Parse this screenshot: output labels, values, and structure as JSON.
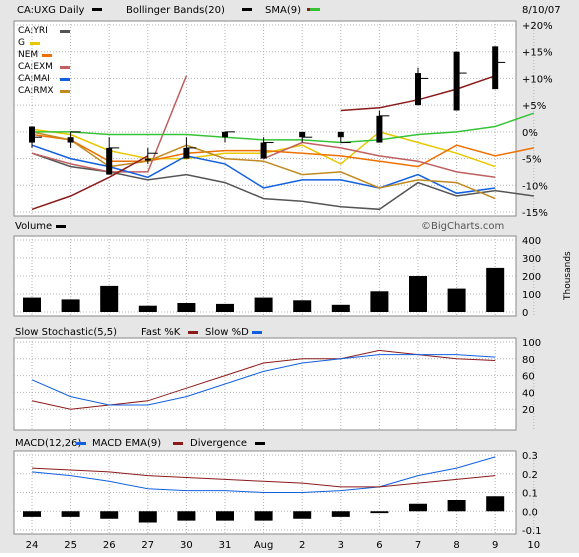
{
  "header": {
    "ticker_label": "CA:UXG Daily",
    "date_label": "8/10/07",
    "legend": [
      {
        "label": "Bollinger Bands(20)",
        "color": "#000000"
      },
      {
        "label": "SMA(9)",
        "color": "#8b1a1a"
      },
      {
        "label": "",
        "color": "#36c436"
      }
    ]
  },
  "price_legend": [
    {
      "label": "CA:YRI",
      "color": "#555555"
    },
    {
      "label": "G",
      "color": "#e8c800"
    },
    {
      "label": "NEM",
      "color": "#ee7000"
    },
    {
      "label": "CA:EXM",
      "color": "#c06060"
    },
    {
      "label": "CA:MAI",
      "color": "#1060e0"
    },
    {
      "label": "CA:RMX",
      "color": "#c08a20"
    }
  ],
  "volume_panel": {
    "title": "Volume",
    "watermark": "©BigCharts.com",
    "unit_label": "Thousands"
  },
  "stochastic_panel": {
    "title": "Slow Stochastic(5,5)",
    "legend": [
      {
        "label": "Fast %K",
        "color": "#8b1a1a"
      },
      {
        "label": "Slow %D",
        "color": "#1060e0"
      }
    ]
  },
  "macd_panel": {
    "title": "MACD(12,26)",
    "legend": [
      {
        "label": "MACD EMA(9)",
        "color": "#1060e0"
      },
      {
        "label": "Divergence",
        "color": "#000000"
      }
    ]
  },
  "colors": {
    "panel_bg": "#ffffff",
    "frame_bg": "#e6e6e6",
    "grid": "#b4b4b4",
    "macd": "#1060e0",
    "signal": "#8b1a1a"
  },
  "chart_data": {
    "type": "line",
    "x_labels": [
      "24",
      "25",
      "26",
      "27",
      "30",
      "31",
      "Aug",
      "2",
      "3",
      "6",
      "7",
      "8",
      "9",
      "10"
    ],
    "price": {
      "ylim": [
        -15,
        20
      ],
      "y_ticks": [
        20,
        15,
        10,
        5,
        0,
        -5,
        -10,
        -15
      ],
      "y_tick_labels": [
        "+20%",
        "+15%",
        "+10%",
        "+5%",
        "0%",
        "-5%",
        "-10%",
        "-15%"
      ],
      "candles": [
        {
          "x": 0,
          "o": -2,
          "c": 1,
          "h": 1,
          "l": -3
        },
        {
          "x": 1,
          "o": -1,
          "c": -2,
          "h": 0,
          "l": -3
        },
        {
          "x": 2,
          "o": -3,
          "c": -8,
          "h": -1,
          "l": -8
        },
        {
          "x": 3,
          "o": -5,
          "c": -5,
          "h": -3,
          "l": -6
        },
        {
          "x": 4,
          "o": -3,
          "c": -5,
          "h": -1,
          "l": -5
        },
        {
          "x": 5,
          "o": -1,
          "c": 0,
          "h": 0,
          "l": -2
        },
        {
          "x": 6,
          "o": -5,
          "c": -2,
          "h": -1,
          "l": -5
        },
        {
          "x": 7,
          "o": 0,
          "c": -1,
          "h": 0,
          "l": -2
        },
        {
          "x": 8,
          "o": -1,
          "c": 0,
          "h": 0,
          "l": -2
        },
        {
          "x": 9,
          "o": -2,
          "c": 3,
          "h": 4,
          "l": -2
        },
        {
          "x": 10,
          "o": 5,
          "c": 11,
          "h": 12,
          "l": 5
        },
        {
          "x": 11,
          "o": 4,
          "c": 15,
          "h": 15,
          "l": 4
        },
        {
          "x": 12,
          "o": 8,
          "c": 16,
          "h": 16,
          "l": 8
        }
      ],
      "candle_close_ticks": [
        -1,
        0,
        -3,
        -4,
        -3,
        0,
        -2,
        -1,
        -2,
        3,
        10,
        11,
        13
      ],
      "series": [
        {
          "name": "CA:YRI",
          "color": "#555555",
          "values": [
            -4,
            -6.5,
            -7.5,
            -9,
            -8,
            -9.5,
            -12.5,
            -13,
            -14,
            -14.5,
            -9.5,
            -12,
            -11,
            -12
          ]
        },
        {
          "name": "G",
          "color": "#e8c800",
          "values": [
            0.5,
            -0.5,
            -3.5,
            -5,
            -5,
            -4,
            -4,
            -2.5,
            -6,
            0,
            -2,
            -4,
            -6.5,
            null
          ]
        },
        {
          "name": "NEM",
          "color": "#ee7000",
          "values": [
            -0.5,
            -1.5,
            -5.5,
            -5.5,
            -4,
            -3.5,
            -3.5,
            -4,
            -4.5,
            -5.5,
            -6.5,
            -2.5,
            -4.5,
            -3
          ]
        },
        {
          "name": "CA:EXM",
          "color": "#c06060",
          "values": [
            -4,
            -6,
            -7.5,
            -7.5,
            10.5,
            null,
            -5,
            -2,
            -3,
            -4.5,
            -5.5,
            -7.5,
            -8.5,
            null
          ]
        },
        {
          "name": "CA:MAI",
          "color": "#1060e0",
          "values": [
            -2.5,
            -5,
            -6.5,
            -8.5,
            -4.5,
            -6,
            -10.5,
            -9,
            -9,
            -10.5,
            -8,
            -11.5,
            -10.5,
            null
          ]
        },
        {
          "name": "CA:RMX",
          "color": "#c08a20",
          "values": [
            0,
            -1.5,
            -6.5,
            -5.5,
            -2.5,
            -5,
            -5.5,
            -8,
            -7.5,
            -10.5,
            -9,
            -9.5,
            -12.5,
            null
          ]
        },
        {
          "name": "",
          "color": "#8b1a1a",
          "values": [
            -14.5,
            -12,
            -8.5,
            -4.5,
            null,
            null,
            null,
            null,
            4,
            4.5,
            6,
            8,
            10.5,
            null
          ]
        },
        {
          "name": "",
          "color": "#36c436",
          "values": [
            0,
            0,
            -0.5,
            -0.5,
            -0.5,
            -1,
            -1.5,
            -1.5,
            -2,
            -1.5,
            -0.5,
            0,
            1,
            3.5
          ]
        }
      ],
      "upper_band": [
        8,
        7,
        5,
        4.5,
        4.5,
        4,
        4,
        4,
        4.5,
        6,
        8,
        10.5,
        10.5
      ]
    },
    "volume": {
      "ylim": [
        0,
        400
      ],
      "y_ticks": [
        400,
        300,
        200,
        100,
        0
      ],
      "values": [
        80,
        70,
        145,
        35,
        50,
        45,
        80,
        65,
        40,
        115,
        200,
        130,
        245
      ]
    },
    "stochastic": {
      "ylim": [
        0,
        100
      ],
      "y_ticks": [
        100,
        80,
        60,
        40,
        20
      ],
      "fast_k": [
        30,
        20,
        25,
        30,
        45,
        60,
        75,
        80,
        80,
        90,
        85,
        80,
        78
      ],
      "slow_d": [
        55,
        35,
        25,
        25,
        35,
        50,
        65,
        75,
        80,
        85,
        85,
        85,
        82
      ]
    },
    "macd": {
      "ylim": [
        -0.1,
        0.3
      ],
      "y_ticks": [
        0.3,
        0.2,
        0.1,
        0.0,
        -0.1
      ],
      "y_tick_labels": [
        "0.3",
        "0.2",
        "0.1",
        "0.0",
        "-0.1"
      ],
      "macd": [
        0.21,
        0.19,
        0.16,
        0.12,
        0.11,
        0.11,
        0.1,
        0.1,
        0.11,
        0.13,
        0.19,
        0.23,
        0.29
      ],
      "signal": [
        0.23,
        0.22,
        0.21,
        0.19,
        0.18,
        0.17,
        0.16,
        0.15,
        0.13,
        0.13,
        0.15,
        0.17,
        0.19
      ],
      "divergence": [
        -0.03,
        -0.03,
        -0.04,
        -0.06,
        -0.05,
        -0.05,
        -0.05,
        -0.04,
        -0.03,
        -0.01,
        0.04,
        0.06,
        0.08
      ]
    }
  }
}
